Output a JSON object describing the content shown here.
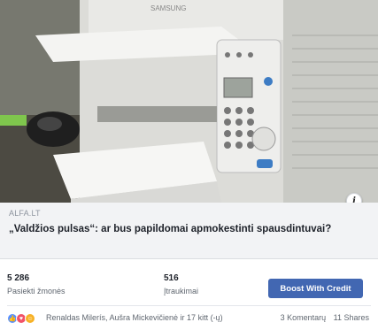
{
  "post": {
    "domain": "ALFA.LT",
    "headline": "„Valdžios pulsas“: ar bus papildomai apmokestinti spausdintuvai?"
  },
  "stats": [
    {
      "value": "5 286",
      "label": "Pasiekti žmonės"
    },
    {
      "value": "516",
      "label": "Įtraukimai"
    }
  ],
  "actions": {
    "boost_label": "Boost With Credit"
  },
  "footer": {
    "reactions": [
      "like",
      "love",
      "haha"
    ],
    "reactors": "Renaldas Milerís, Aušra Mickevičienė ir 17 kitt (-ų)",
    "comments": "3 Komentarų",
    "shares": "11 Shares"
  },
  "colors": {
    "boost": "#4267b2",
    "preview_bg": "#f2f3f5",
    "like": "#5890ff",
    "love": "#f25268",
    "haha": "#f7b125"
  },
  "icons": {
    "info": "info-icon",
    "photo": "printer-photo"
  }
}
